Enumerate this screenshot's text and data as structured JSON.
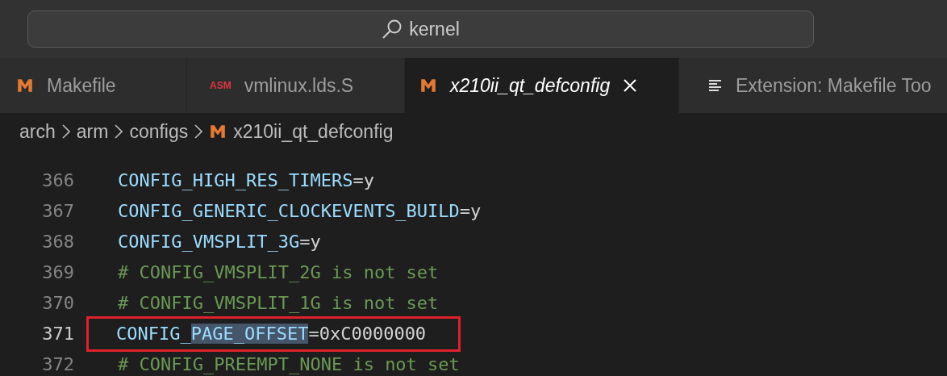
{
  "search": {
    "value": "kernel"
  },
  "tabs": [
    {
      "label": "Makefile",
      "kind": "m",
      "selected": false,
      "preview": false
    },
    {
      "label": "vmlinux.lds.S",
      "kind": "asm",
      "icon_text": "ASM",
      "selected": false,
      "preview": false
    },
    {
      "label": "x210ii_qt_defconfig",
      "kind": "m",
      "selected": true,
      "preview": true
    },
    {
      "label": "Extension: Makefile Too",
      "kind": "lines",
      "selected": false,
      "preview": false
    }
  ],
  "breadcrumbs": [
    {
      "label": "arch",
      "kind": "folder"
    },
    {
      "label": "arm",
      "kind": "folder"
    },
    {
      "label": "configs",
      "kind": "folder"
    },
    {
      "label": "x210ii_qt_defconfig",
      "kind": "file"
    }
  ],
  "lines": [
    {
      "number": "366",
      "current": false,
      "boxed": false,
      "segments": [
        {
          "kind": "key",
          "text": "CONFIG_HIGH_RES_TIMERS",
          "highlighted": false
        },
        {
          "kind": "op",
          "text": "=y",
          "highlighted": false
        }
      ]
    },
    {
      "number": "367",
      "current": false,
      "boxed": false,
      "segments": [
        {
          "kind": "key",
          "text": "CONFIG_GENERIC_CLOCKEVENTS_BUILD",
          "highlighted": false
        },
        {
          "kind": "op",
          "text": "=y",
          "highlighted": false
        }
      ]
    },
    {
      "number": "368",
      "current": false,
      "boxed": false,
      "segments": [
        {
          "kind": "key",
          "text": "CONFIG_VMSPLIT_3G",
          "highlighted": false
        },
        {
          "kind": "op",
          "text": "=y",
          "highlighted": false
        }
      ]
    },
    {
      "number": "369",
      "current": false,
      "boxed": false,
      "segments": [
        {
          "kind": "comment",
          "text": "# CONFIG_VMSPLIT_2G is not set",
          "highlighted": false
        }
      ]
    },
    {
      "number": "370",
      "current": false,
      "boxed": false,
      "segments": [
        {
          "kind": "comment",
          "text": "# CONFIG_VMSPLIT_1G is not set",
          "highlighted": false
        }
      ]
    },
    {
      "number": "371",
      "current": true,
      "boxed": true,
      "segments": [
        {
          "kind": "key",
          "text": "CONFIG_",
          "highlighted": false
        },
        {
          "kind": "key",
          "text": "PAGE_OFFSET",
          "highlighted": true
        },
        {
          "kind": "op",
          "text": "=0xC0000000",
          "highlighted": false
        }
      ]
    },
    {
      "number": "372",
      "current": false,
      "boxed": false,
      "segments": [
        {
          "kind": "comment",
          "text": "# CONFIG_PREEMPT_NONE is not set",
          "highlighted": false
        }
      ]
    }
  ]
}
